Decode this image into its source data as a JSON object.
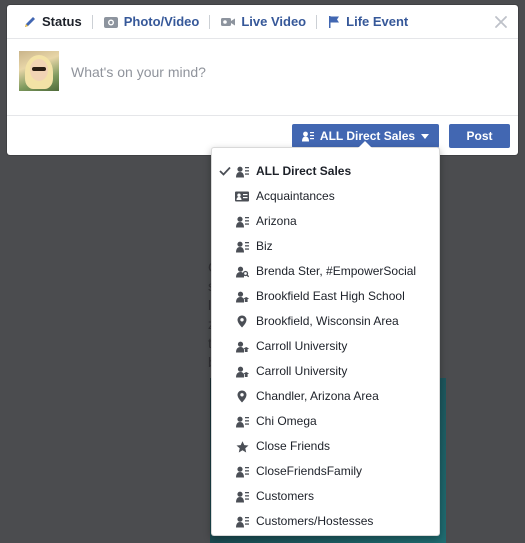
{
  "tabs": [
    {
      "label": "Status",
      "icon": "pencil-icon"
    },
    {
      "label": "Photo/Video",
      "icon": "camera-icon"
    },
    {
      "label": "Live Video",
      "icon": "video-camera-icon"
    },
    {
      "label": "Life Event",
      "icon": "flag-icon"
    }
  ],
  "composer": {
    "placeholder": "What's on your mind?"
  },
  "footer": {
    "audience_label": "ALL Direct Sales",
    "post_label": "Post"
  },
  "background": {
    "lines": [
      "C",
      "s",
      "l",
      "z",
      "t",
      "b"
    ]
  },
  "dropdown": {
    "items": [
      {
        "label": "ALL Direct Sales",
        "icon": "list-icon",
        "selected": true
      },
      {
        "label": "Acquaintances",
        "icon": "id-card-icon"
      },
      {
        "label": "Arizona",
        "icon": "list-icon"
      },
      {
        "label": "Biz",
        "icon": "list-icon"
      },
      {
        "label": "Brenda Ster, #EmpowerSocial",
        "icon": "person-search-icon"
      },
      {
        "label": "Brookfield East High School",
        "icon": "school-icon"
      },
      {
        "label": "Brookfield, Wisconsin Area",
        "icon": "location-pin-icon"
      },
      {
        "label": "Carroll University",
        "icon": "school-icon"
      },
      {
        "label": "Carroll University",
        "icon": "school-icon"
      },
      {
        "label": "Chandler, Arizona Area",
        "icon": "location-pin-icon"
      },
      {
        "label": "Chi Omega",
        "icon": "list-icon"
      },
      {
        "label": "Close Friends",
        "icon": "star-icon"
      },
      {
        "label": "CloseFriendsFamily",
        "icon": "list-icon"
      },
      {
        "label": "Customers",
        "icon": "list-icon"
      },
      {
        "label": "Customers/Hostesses",
        "icon": "list-icon"
      }
    ]
  }
}
